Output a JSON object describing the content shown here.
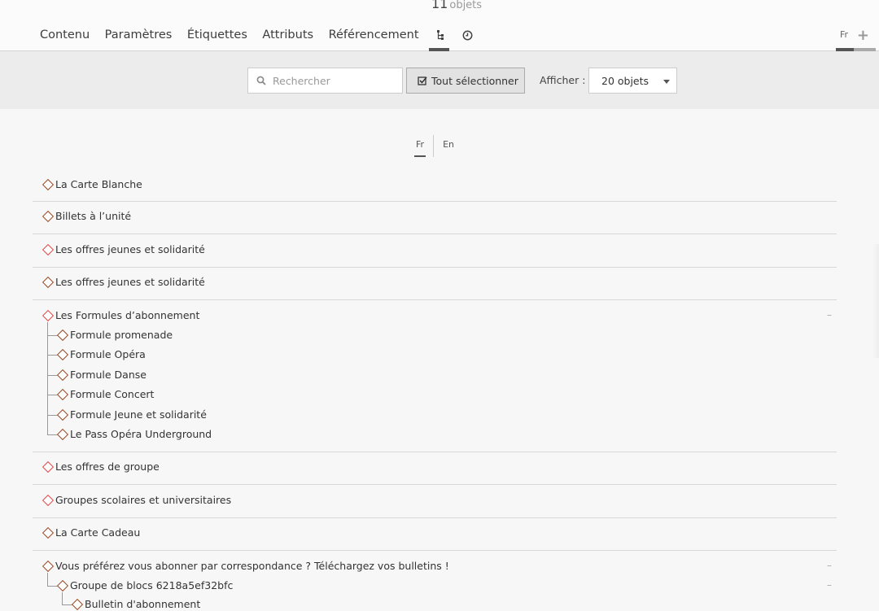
{
  "header": {
    "count_value": "11",
    "count_unit": "objets",
    "tabs": [
      "Contenu",
      "Paramètres",
      "Étiquettes",
      "Attributs",
      "Référencement"
    ],
    "icon_tabs": [
      "tree-icon",
      "clock-icon"
    ],
    "lang": "Fr",
    "add_icon": "plus-icon"
  },
  "toolbar": {
    "search_placeholder": "Rechercher",
    "select_all_label": "Tout sélectionner",
    "show_label": "Afficher :",
    "show_value": "20 objets"
  },
  "lang_switch": [
    "Fr",
    "En"
  ],
  "tree": {
    "items": [
      "La Carte Blanche",
      "Billets à l’unité",
      "Les offres jeunes et solidarité",
      "Les offres jeunes et solidarité",
      "Les Formules d’abonnement",
      "Les offres de groupe",
      "Groupes scolaires et universitaires",
      "La Carte Cadeau",
      "Vous préférez vous abonner par correspondance ? Téléchargez vos bulletins !"
    ],
    "formules_children": [
      "Formule promenade",
      "Formule Opéra",
      "Formule Danse",
      "Formule Concert",
      "Formule Jeune et solidarité",
      "Le Pass Opéra Underground"
    ],
    "correspondance_child": "Groupe de blocs 6218a5ef32bfc",
    "correspondance_grandchild": "Bulletin d'abonnement",
    "collapse_symbol": "–"
  },
  "colors": {
    "diamond_red": "#e04848",
    "diamond_brown": "#9b4a22"
  }
}
